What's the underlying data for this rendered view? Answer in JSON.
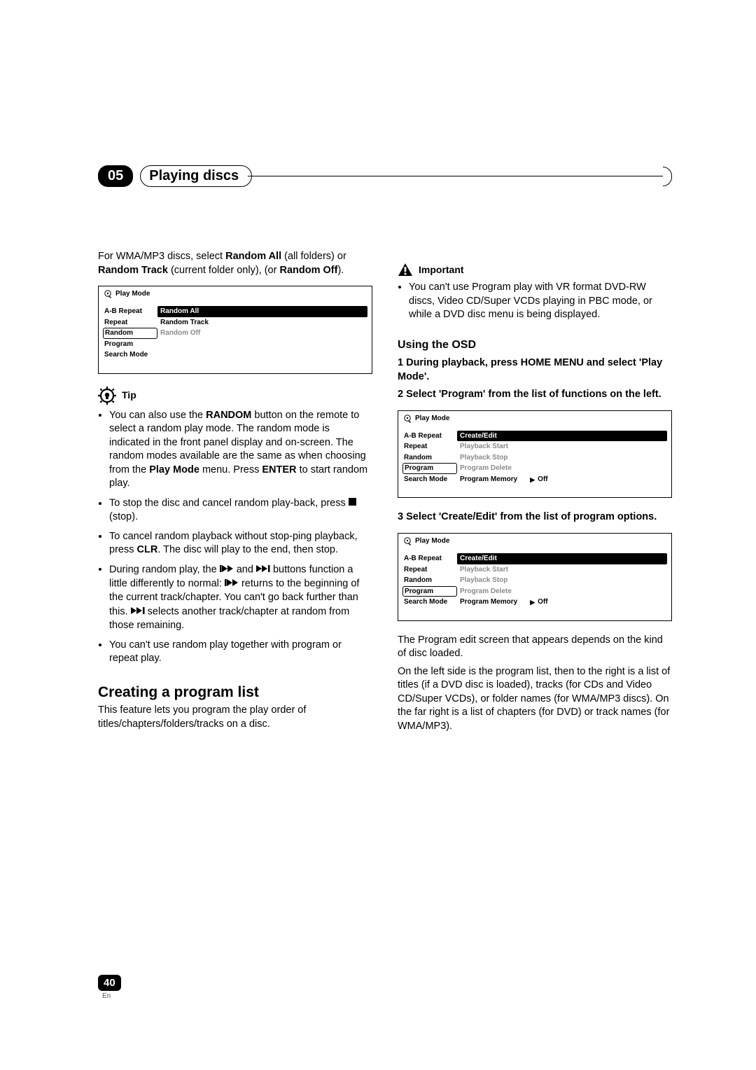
{
  "header": {
    "chapter_num": "05",
    "chapter_title": "Playing discs"
  },
  "left": {
    "intro_pre": "For WMA/MP3 discs, select ",
    "intro_b1": "Random All",
    "intro_mid1": " (all folders) or ",
    "intro_b2": "Random Track",
    "intro_mid2": " (current folder only), (or ",
    "intro_b3": "Random Off",
    "intro_end": ").",
    "menu1": {
      "title": "Play Mode",
      "left_items": [
        "A-B Repeat",
        "Repeat",
        "Random",
        "Program",
        "Search Mode"
      ],
      "selected_left": "Random",
      "right_rows": [
        {
          "label": "Random All",
          "highlight": true
        },
        {
          "label": "Random Track"
        },
        {
          "label": "Random Off",
          "dim": true
        }
      ]
    },
    "tip_label": "Tip",
    "tips": {
      "t1_pre": "You can also use the ",
      "t1_b1": "RANDOM",
      "t1_mid": " button on the remote to select a random play mode. The random mode is indicated in the front panel display and on-screen. The random modes available are the same as when choosing from the ",
      "t1_b2": "Play Mode",
      "t1_mid2": " menu. Press ",
      "t1_b3": "ENTER",
      "t1_end": " to start random play.",
      "t2_pre": "To stop the disc and cancel random play-back, press ",
      "t2_end": " (stop).",
      "t3_pre": "To cancel random playback without stop-ping playback, press ",
      "t3_b1": "CLR",
      "t3_end": ". The disc will play to the end, then stop.",
      "t4_pre": "During random play, the ",
      "t4_mid1": " and ",
      "t4_mid2": " buttons function a little differently to normal: ",
      "t4_mid3": " returns to the beginning of the current track/chapter. You can't go back further than this. ",
      "t4_end": " selects another track/chapter at random from those remaining.",
      "t5": "You can't use random play together with program or repeat play."
    },
    "h2": "Creating a program list",
    "h2_body": "This feature lets you program the play order of titles/chapters/folders/tracks on a disc."
  },
  "right": {
    "important_label": "Important",
    "important_body": "You can't use Program play with VR format DVD-RW discs, Video CD/Super VCDs playing in PBC mode, or while a DVD disc menu is being displayed.",
    "h3": "Using the OSD",
    "step1": "1    During playback, press HOME MENU and select 'Play Mode'.",
    "step2": "2    Select 'Program' from the list of functions on the left.",
    "menu2": {
      "title": "Play Mode",
      "left_items": [
        "A-B Repeat",
        "Repeat",
        "Random",
        "Program",
        "Search Mode"
      ],
      "selected_left": "Program",
      "right_rows": [
        {
          "label": "Create/Edit",
          "highlight": true
        },
        {
          "label": "Playback Start",
          "dim": true
        },
        {
          "label": "Playback Stop",
          "dim": true
        },
        {
          "label": "Program Delete",
          "dim": true
        },
        {
          "label": "Program Memory",
          "extra": "Off"
        }
      ]
    },
    "step3": "3    Select 'Create/Edit' from the list of program options.",
    "menu3": {
      "title": "Play Mode",
      "left_items": [
        "A-B Repeat",
        "Repeat",
        "Random",
        "Program",
        "Search Mode"
      ],
      "selected_left": "Program",
      "right_rows": [
        {
          "label": "Create/Edit",
          "highlight": true
        },
        {
          "label": "Playback Start",
          "dim": true
        },
        {
          "label": "Playback Stop",
          "dim": true
        },
        {
          "label": "Program Delete",
          "dim": true
        },
        {
          "label": "Program Memory",
          "extra": "Off"
        }
      ]
    },
    "after1": "The Program edit screen that appears depends on the kind of disc loaded.",
    "after2": "On the left side is the program list, then to the right is a list of titles (if a DVD disc is loaded), tracks (for CDs and Video CD/Super VCDs), or folder names (for WMA/MP3 discs). On the far right is a list of chapters (for DVD) or track names (for WMA/MP3)."
  },
  "footer": {
    "page": "40",
    "lang": "En"
  }
}
